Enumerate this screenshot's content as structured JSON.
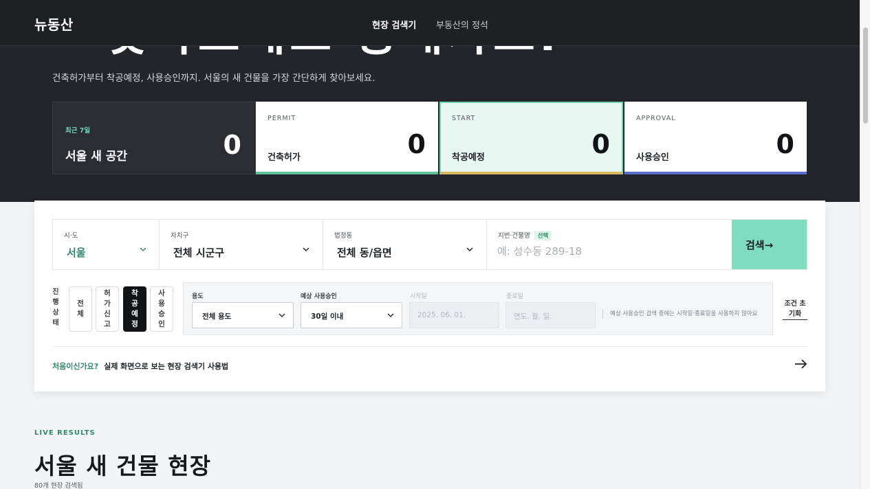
{
  "nav": {
    "logo": "뉴동산",
    "links": [
      {
        "label": "현장 검색기",
        "active": true
      },
      {
        "label": "부동산의 정석",
        "active": false
      }
    ]
  },
  "hero": {
    "headline_prefix": "“",
    "headline": "찾아보세요 동네가요.",
    "subtitle": "건축허가부터 착공예정, 사용승인까지. 서울의 새 건물을 가장 간단하게 찾아보세요."
  },
  "stats": {
    "summary": {
      "badge": "최근 7일",
      "title": "서울 새 공간",
      "value": "0"
    },
    "permit": {
      "eng": "PERMIT",
      "kor": "건축허가",
      "value": "0",
      "color": "#5fbf9a"
    },
    "start": {
      "eng": "START",
      "kor": "착공예정",
      "value": "0",
      "color": "#d9b75e"
    },
    "approval": {
      "eng": "APPROVAL",
      "kor": "사용승인",
      "value": "0",
      "color": "#5a6fd0"
    }
  },
  "search": {
    "sido": {
      "label": "시·도",
      "value": "서울"
    },
    "gu": {
      "label": "자치구",
      "value": "전체 시군구"
    },
    "dong": {
      "label": "법정동",
      "value": "전체 동/읍면"
    },
    "address": {
      "label": "지번·건물명",
      "badge": "선택",
      "placeholder": "예: 성수동 289-18",
      "value": ""
    },
    "button": "검색→"
  },
  "status": {
    "label": "진행상태",
    "options": [
      {
        "label": "전체",
        "active": false
      },
      {
        "label": "허가신고",
        "active": false
      },
      {
        "label": "착공예정",
        "active": true
      },
      {
        "label": "사용승인",
        "active": false
      }
    ]
  },
  "filters": {
    "usage": {
      "label": "용도",
      "value": "전체 용도"
    },
    "approval": {
      "label": "예상 사용승인",
      "value": "30일 이내"
    },
    "start_date": {
      "label": "시작일",
      "value": "2025. 06. 01."
    },
    "end_date": {
      "label": "종료일",
      "value": "연도. 월. 일."
    },
    "note": "예상 사용승인 검색 중에는 시작일·종료일을 사용하지 않아요",
    "reset": "조건 초기화"
  },
  "guide": {
    "question": "처음이신가요?",
    "text": "실제 화면으로 보는 현장 검색기 사용법"
  },
  "results": {
    "eyebrow": "LIVE RESULTS",
    "title": "서울 새 건물 현장",
    "count": "80개 현장 검색됨"
  },
  "colors": {
    "accent": "#7fdcbf",
    "accent_text": "#2f8a6a",
    "dark": "#24252b"
  }
}
